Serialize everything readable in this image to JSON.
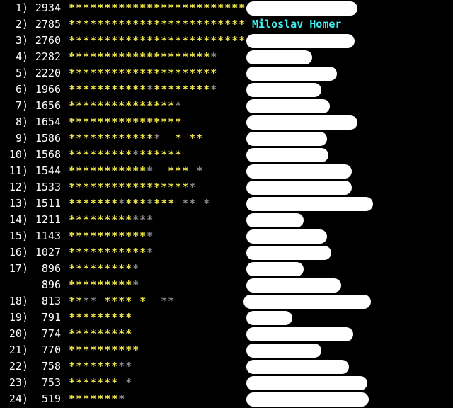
{
  "leaderboard": {
    "rows": [
      {
        "rank": "1)",
        "score": "2934",
        "stars": "yyyyyyyyyyyyyyyyyyyyyyyyy",
        "name": ""
      },
      {
        "rank": "2)",
        "score": "2785",
        "stars": "yyyyyyyyyyyyyyyyyyyyyyyyy",
        "name": "Miloslav Homer"
      },
      {
        "rank": "3)",
        "score": "2760",
        "stars": "yyyyyyyyyyyyyyyyyyyyyyyyy",
        "name": ""
      },
      {
        "rank": "4)",
        "score": "2282",
        "stars": "yyyyyyyyyyyyyyyyyyyyg",
        "name": ""
      },
      {
        "rank": "5)",
        "score": "2220",
        "stars": "yyyyyyyyyyyyyyyyyyyyy",
        "name": ""
      },
      {
        "rank": "6)",
        "score": "1966",
        "stars": "yyyyyyyyyyygyyyyyyyyg",
        "name": ""
      },
      {
        "rank": "7)",
        "score": "1656",
        "stars": "yyyyyyyyyyyyyyyg",
        "name": ""
      },
      {
        "rank": "8)",
        "score": "1654",
        "stars": "yyyyyyyyyyyyyyyy",
        "name": ""
      },
      {
        "rank": "9)",
        "score": "1586",
        "stars": "yyyyyyyyyyyygbbybyy",
        "name": ""
      },
      {
        "rank": "10)",
        "score": "1568",
        "stars": "yyyyyyyyygyyyyyy",
        "name": ""
      },
      {
        "rank": "11)",
        "score": "1544",
        "stars": "yyyyyyyyyyygbbyyybg",
        "name": ""
      },
      {
        "rank": "12)",
        "score": "1533",
        "stars": "yyyyyyyyyyyyyyyyyg",
        "name": ""
      },
      {
        "rank": "13)",
        "score": "1511",
        "stars": "yyyyyyygyyygyyybggbg",
        "name": ""
      },
      {
        "rank": "14)",
        "score": "1211",
        "stars": "yyyyyyyyyggg",
        "name": ""
      },
      {
        "rank": "15)",
        "score": "1143",
        "stars": "yyyyyyyyyyyg",
        "name": ""
      },
      {
        "rank": "16)",
        "score": "1027",
        "stars": "yyyyyyyyyyyg",
        "name": ""
      },
      {
        "rank": "17)",
        "score": "896",
        "stars": "yyyyyyyyyg",
        "name": ""
      },
      {
        "rank": "",
        "score": "896",
        "stars": "yyyyyyyyyg",
        "name": ""
      },
      {
        "rank": "18)",
        "score": "813",
        "stars": "yyggbyyyybybbgg",
        "name": ""
      },
      {
        "rank": "19)",
        "score": "791",
        "stars": "yyyyyyyyy",
        "name": ""
      },
      {
        "rank": "20)",
        "score": "774",
        "stars": "yyyyyyyyy",
        "name": ""
      },
      {
        "rank": "21)",
        "score": "770",
        "stars": "yyyyyyyyyy",
        "name": ""
      },
      {
        "rank": "22)",
        "score": "758",
        "stars": "yyyyyyygg",
        "name": ""
      },
      {
        "rank": "23)",
        "score": "753",
        "stars": "yyyyyyybg",
        "name": ""
      },
      {
        "rank": "24)",
        "score": "519",
        "stars": "yyyyyyyg",
        "name": ""
      }
    ]
  },
  "colors": {
    "background": "#000000",
    "text": "#ffffff",
    "star_gold": "#f2e84a",
    "star_silver": "#8a8a8a",
    "highlight_name": "#3ff0f0"
  }
}
